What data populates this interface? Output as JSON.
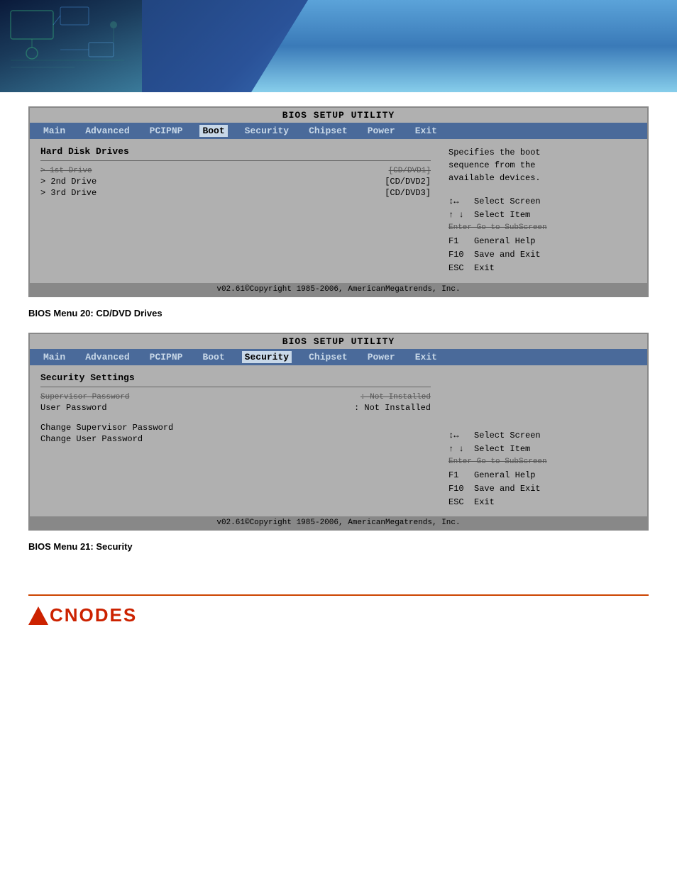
{
  "header": {
    "alt": "Circuit board header banner"
  },
  "bios_menu1": {
    "title": "BIOS SETUP UTILITY",
    "menu_items": [
      {
        "label": "Main",
        "active": false
      },
      {
        "label": "Advanced",
        "active": false
      },
      {
        "label": "PCIPNP",
        "active": false
      },
      {
        "label": "Boot",
        "active": true
      },
      {
        "label": "Security",
        "active": false
      },
      {
        "label": "Chipset",
        "active": false
      },
      {
        "label": "Power",
        "active": false
      },
      {
        "label": "Exit",
        "active": false
      }
    ],
    "section_title": "Hard Disk Drives",
    "items": [
      {
        "label": "> 1st Drive",
        "value": "[CD/DVD1]",
        "strikethrough": true
      },
      {
        "label": "> 2nd Drive",
        "value": "[CD/DVD2]",
        "strikethrough": false
      },
      {
        "label": "> 3rd Drive",
        "value": "[CD/DVD3]",
        "strikethrough": false
      }
    ],
    "help_text": "Specifies the boot\nsequence from the\navailable devices.",
    "key_help": [
      {
        "key": "↕↔",
        "desc": "Select Screen",
        "strikethrough": false
      },
      {
        "key": "↑ ↓",
        "desc": "Select Item",
        "strikethrough": false
      },
      {
        "key": "Enter Go to SubScreen",
        "desc": "",
        "strikethrough": true
      },
      {
        "key": "F1",
        "desc": "General Help",
        "strikethrough": false
      },
      {
        "key": "F10",
        "desc": "Save and Exit",
        "strikethrough": false
      },
      {
        "key": "ESC",
        "desc": "Exit",
        "strikethrough": false
      }
    ],
    "footer": "v02.61©Copyright 1985-2006, AmericanMegatrends, Inc.",
    "caption": "BIOS Menu 20: CD/DVD Drives"
  },
  "bios_menu2": {
    "title": "BIOS SETUP UTILITY",
    "menu_items": [
      {
        "label": "Main",
        "active": false
      },
      {
        "label": "Advanced",
        "active": false
      },
      {
        "label": "PCIPNP",
        "active": false
      },
      {
        "label": "Boot",
        "active": false
      },
      {
        "label": "Security",
        "active": true
      },
      {
        "label": "Chipset",
        "active": false
      },
      {
        "label": "Power",
        "active": false
      },
      {
        "label": "Exit",
        "active": false
      }
    ],
    "section_title": "Security Settings",
    "items": [
      {
        "label": "Supervisor Password",
        "value": ": Not Installed",
        "strikethrough": true
      },
      {
        "label": "User Password",
        "value": ": Not Installed",
        "strikethrough": false
      },
      {
        "label": "",
        "value": "",
        "spacer": true
      },
      {
        "label": "Change Supervisor Password",
        "value": "",
        "strikethrough": false
      },
      {
        "label": "Change User Password",
        "value": "",
        "strikethrough": false
      }
    ],
    "help_text": "",
    "key_help": [
      {
        "key": "↕↔",
        "desc": "Select Screen",
        "strikethrough": false
      },
      {
        "key": "↑ ↓",
        "desc": "Select Item",
        "strikethrough": false
      },
      {
        "key": "Enter Go to SubScreen",
        "desc": "",
        "strikethrough": true
      },
      {
        "key": "F1",
        "desc": "General Help",
        "strikethrough": false
      },
      {
        "key": "F10",
        "desc": "Save and Exit",
        "strikethrough": false
      },
      {
        "key": "ESC",
        "desc": "Exit",
        "strikethrough": false
      }
    ],
    "footer": "v02.61©Copyright 1985-2006, AmericanMegatrends, Inc.",
    "caption": "BIOS Menu 21: Security"
  },
  "acnodes": {
    "logo": "ACNODES"
  }
}
